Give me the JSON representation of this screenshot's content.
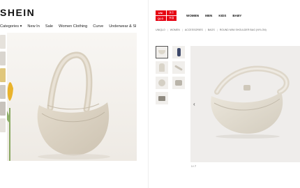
{
  "shein": {
    "logo": "SHEIN",
    "nav": [
      "Categories ▾",
      "New In",
      "Sale",
      "Women Clothing",
      "Curve",
      "Underwear & Sl"
    ]
  },
  "uniqlo": {
    "logo": [
      "UNI",
      "QLO",
      "ユニ",
      "クロ"
    ],
    "nav": [
      "WOMEN",
      "MEN",
      "KIDS",
      "BABY"
    ],
    "breadcrumb": [
      "UNIQLO",
      "WOMEN",
      "ACCESSORIES",
      "BAGS",
      "ROUND MINI SHOULDER BAG (NYLON)"
    ],
    "prev_arrow": "‹",
    "image_counter": "1 / 7"
  },
  "colors": {
    "uniqlo_red": "#e60012",
    "bag_beige": "#ddd6c8",
    "shein_photo_bg": "#f6f3ef",
    "uniqlo_photo_bg": "#efedeb"
  }
}
